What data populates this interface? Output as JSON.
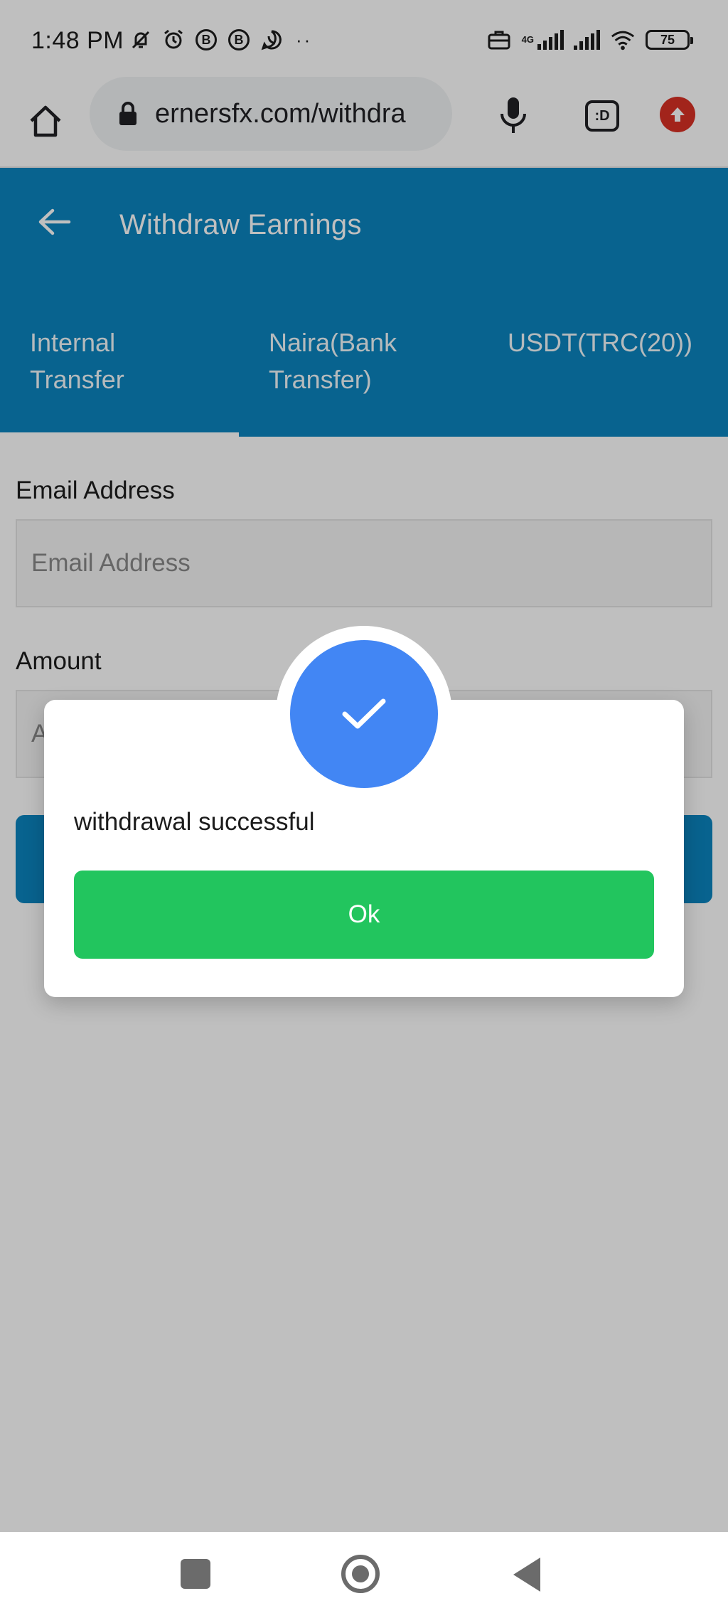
{
  "status_bar": {
    "time": "1:48 PM",
    "network_label": "4G",
    "battery": "75"
  },
  "browser": {
    "url": "ernersfx.com/withdra",
    "tabs_label": ":D"
  },
  "app": {
    "title": "Withdraw Earnings",
    "accent_color": "#0b84bf",
    "tabs": [
      {
        "label_line1": "Internal",
        "label_line2": "Transfer",
        "active": true
      },
      {
        "label_line1": "Naira(Bank",
        "label_line2": "Transfer)",
        "active": false
      },
      {
        "label_line1": "USDT(TRC(20))",
        "label_line2": "",
        "active": false
      }
    ]
  },
  "form": {
    "email_label": "Email Address",
    "email_placeholder": "Email Address",
    "amount_label": "Amount",
    "amount_placeholder": "A"
  },
  "dialog": {
    "message": "withdrawal successful",
    "ok_label": "Ok",
    "icon": "check-icon",
    "ok_color": "#22c55e",
    "icon_color": "#4286f4"
  }
}
